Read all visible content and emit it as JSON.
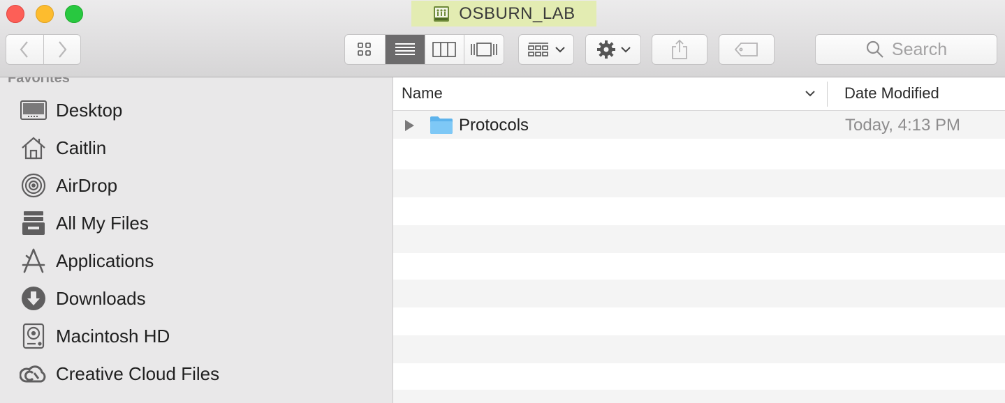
{
  "window": {
    "title": "OSBURN_LAB",
    "title_highlight_color": "#e3ecb2"
  },
  "toolbar": {
    "view_modes": [
      "icon-view",
      "list-view",
      "column-view",
      "cover-flow-view"
    ],
    "active_view": "list-view",
    "search_placeholder": "Search"
  },
  "sidebar": {
    "heading": "Favorites",
    "items": [
      {
        "label": "Desktop",
        "icon": "desktop-icon"
      },
      {
        "label": "Caitlin",
        "icon": "home-icon"
      },
      {
        "label": "AirDrop",
        "icon": "airdrop-icon"
      },
      {
        "label": "All My Files",
        "icon": "all-files-icon"
      },
      {
        "label": "Applications",
        "icon": "applications-icon"
      },
      {
        "label": "Downloads",
        "icon": "downloads-icon"
      },
      {
        "label": "Macintosh HD",
        "icon": "hard-drive-icon"
      },
      {
        "label": "Creative Cloud Files",
        "icon": "creative-cloud-icon"
      }
    ]
  },
  "file_list": {
    "columns": {
      "name": "Name",
      "date": "Date Modified"
    },
    "rows": [
      {
        "name": "Protocols",
        "date": "Today, 4:13 PM",
        "kind": "folder"
      }
    ]
  }
}
